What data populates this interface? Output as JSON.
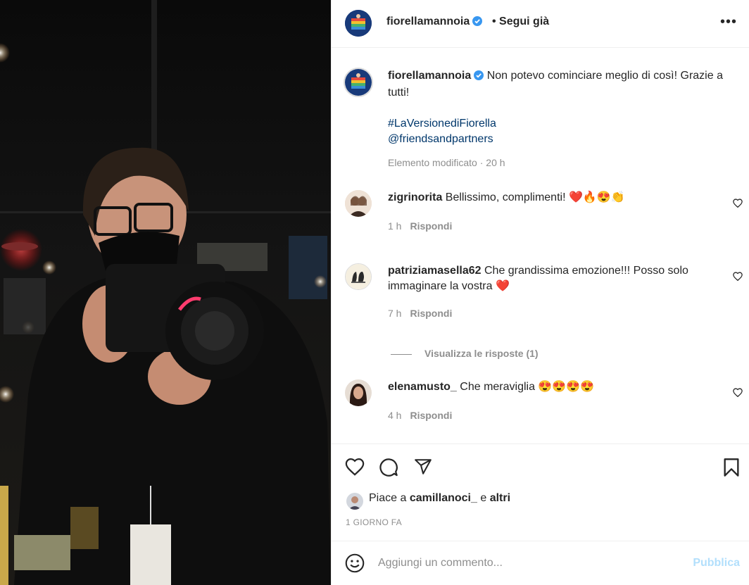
{
  "post": {
    "author": "fiorellamannoia",
    "follow_label": "• Segui già",
    "more_label": "•••"
  },
  "caption": {
    "author": "fiorellamannoia",
    "text": "Non potevo cominciare meglio di così! Grazie a tutti!",
    "hashtag": "#LaVersionediFiorella",
    "mention": "@friendsandpartners",
    "meta": "Elemento modificato · 20 h"
  },
  "comments": [
    {
      "user": "zigrinorita",
      "text": "Bellissimo, complimenti! ❤️🔥😍👏",
      "time": "1 h",
      "reply": "Rispondi"
    },
    {
      "user": "patriziamasella62",
      "text": "Che grandissima emozione!!! Posso solo immaginare la vostra ❤️",
      "time": "7 h",
      "reply": "Rispondi"
    },
    {
      "user": "elenamusto_",
      "text": "Che meraviglia 😍😍😍😍",
      "time": "4 h",
      "reply": "Rispondi"
    }
  ],
  "view_replies": "Visualizza le risposte (1)",
  "likes": {
    "prefix": "Piace a",
    "user": "camillanoci_",
    "suffix": "e",
    "others": "altri"
  },
  "date": "1 GIORNO FA",
  "composer": {
    "placeholder": "Aggiungi un commento...",
    "publish": "Pubblica"
  },
  "colors": {
    "link": "#00376b",
    "verified": "#3897f0",
    "publish": "#b2dffc",
    "secondary": "#8e8e8e"
  },
  "icons": [
    "heart-icon",
    "comment-icon",
    "share-icon",
    "bookmark-icon",
    "emoji-icon",
    "verified-icon",
    "more-icon"
  ]
}
